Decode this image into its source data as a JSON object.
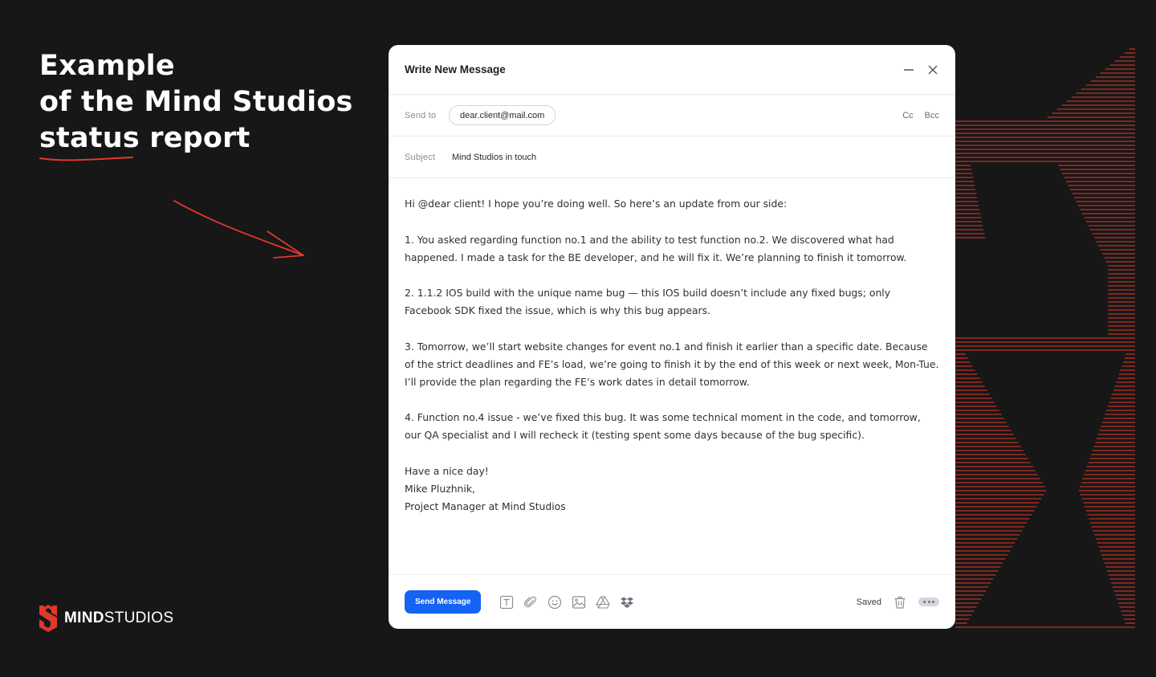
{
  "headline": {
    "line1": "Example",
    "line2": "of the Mind Studios",
    "line3": "status report"
  },
  "logo": {
    "bold": "MIND",
    "light": "STUDIOS"
  },
  "colors": {
    "accent": "#e2382b",
    "button": "#1463f3",
    "background": "#171717"
  },
  "mail": {
    "title": "Write New Message",
    "send_to_label": "Send to",
    "send_to_value": "dear.client@mail.com",
    "cc": "Cc",
    "bcc": "Bcc",
    "subject_label": "Subject",
    "subject_value": "Mind Studios in touch",
    "body": {
      "greeting": "Hi @dear client! I hope you’re doing well. So here’s an update from our side:",
      "p1": "1. You asked regarding function no.1 and the ability to test function no.2. We discovered what had happened. I made a task for the BE developer, and he will fix it. We’re planning to finish it tomorrow.",
      "p2": "2. 1.1.2 IOS build with the unique name bug — this IOS build doesn’t include any fixed bugs; only Facebook SDK fixed the issue, which is why this bug appears.",
      "p3": "3. Tomorrow, we’ll start website changes for event no.1 and finish it earlier than a specific date. Because of the strict deadlines and FE’s load, we’re going to finish it by the end of this week or next week, Mon-Tue. I’ll provide the plan regarding the FE’s work dates in detail tomorrow.",
      "p4": "4. Function no.4 issue - we’ve fixed this bug. It was some technical moment in the code, and tomorrow, our QA specialist and I will recheck it (testing spent some days because of the bug specific).",
      "sign1": "Have a nice day!",
      "sign2": "Mike Pluzhnik,",
      "sign3": "Project Manager at Mind Studios"
    },
    "send_label": "Send Message",
    "saved_label": "Saved",
    "toolbar_icons": [
      "text-format-icon",
      "attachment-icon",
      "emoji-icon",
      "image-icon",
      "google-drive-icon",
      "dropbox-icon"
    ]
  }
}
